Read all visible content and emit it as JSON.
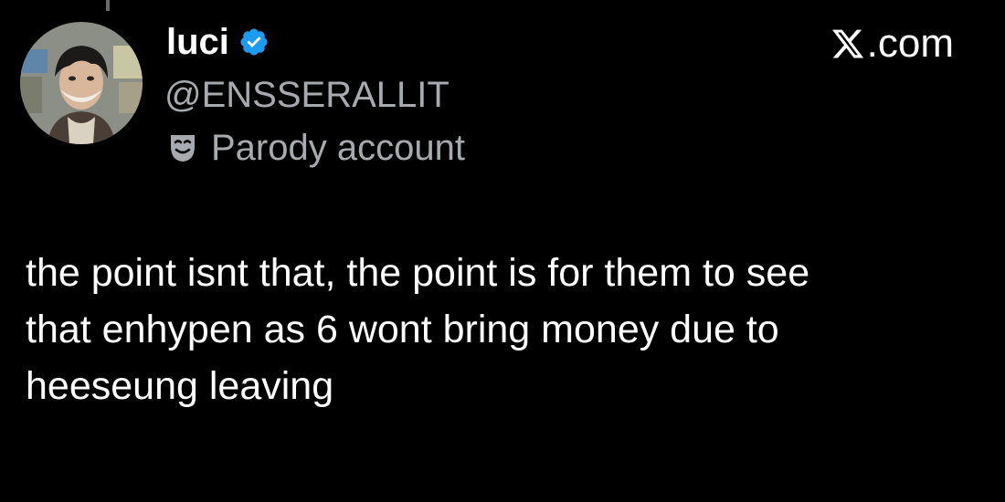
{
  "tweet": {
    "author": {
      "display_name": "luci",
      "handle": "@ENSSERALLIT",
      "label": "Parody account",
      "verified_color": "#1d9bf0"
    },
    "brand": {
      "suffix": ".com"
    },
    "text_lines": [
      "the point isnt that, the point is for them to see",
      "that enhypen as 6 wont bring money due to",
      "heeseung leaving"
    ]
  },
  "icons": {
    "verified": "verified-badge-icon",
    "parody": "theater-mask-icon",
    "brand_logo": "x-logo-icon"
  },
  "colors": {
    "background": "#000000",
    "primary_text": "#ffffff",
    "secondary_text": "#a7aaae"
  }
}
